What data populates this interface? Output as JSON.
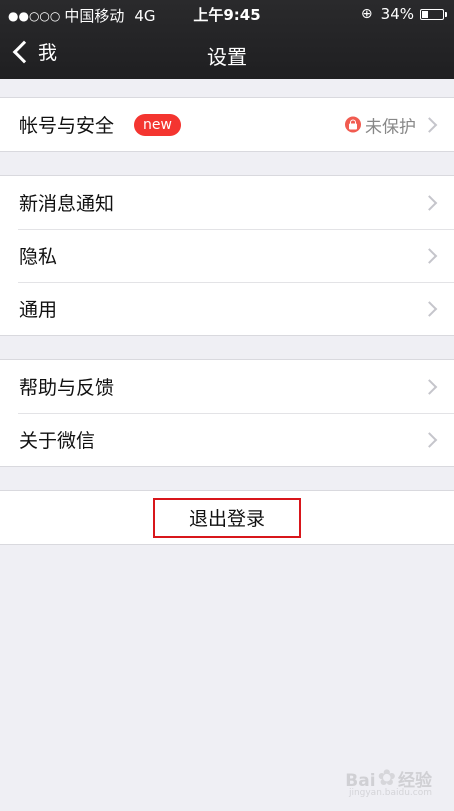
{
  "status_bar": {
    "signal": "●●○○○",
    "carrier": "中国移动",
    "network": "4G",
    "time": "上午9:45",
    "rotation_lock_icon": "rotation-lock-icon",
    "battery_percent": "34%",
    "battery_level": 0.34
  },
  "nav": {
    "back_label": "我",
    "title": "设置"
  },
  "groups": {
    "account": {
      "label": "帐号与安全",
      "badge": "new",
      "status": "未保护"
    },
    "general": [
      {
        "label": "新消息通知"
      },
      {
        "label": "隐私"
      },
      {
        "label": "通用"
      }
    ],
    "about": [
      {
        "label": "帮助与反馈"
      },
      {
        "label": "关于微信"
      }
    ]
  },
  "logout": {
    "label": "退出登录"
  },
  "watermark": {
    "text_left": "Bai",
    "text_right": "经验",
    "sub": "jingyan.baidu.com"
  },
  "colors": {
    "nav_bg": "#2a2a2c",
    "page_bg": "#efeff4",
    "badge": "#f43530",
    "highlight_box": "#d8161b"
  }
}
